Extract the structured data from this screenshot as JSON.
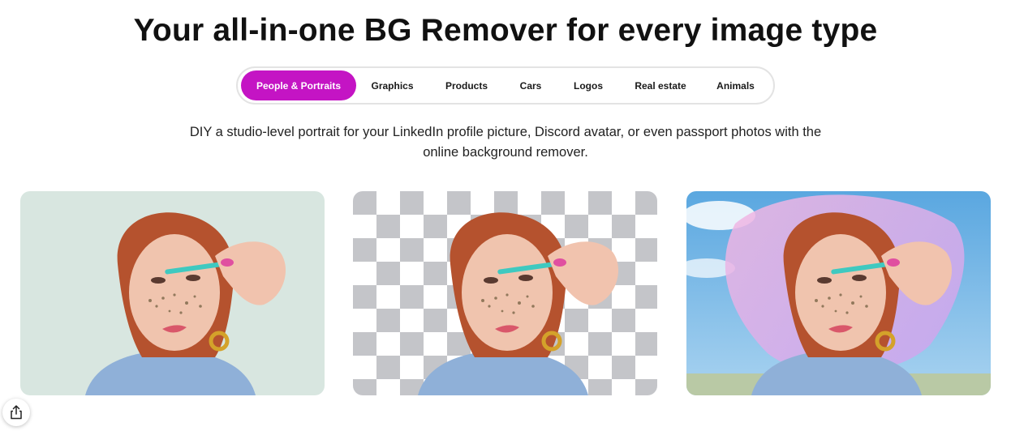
{
  "headline": "Your all-in-one BG Remover for every image type",
  "tabs": [
    {
      "label": "People & Portraits",
      "active": true
    },
    {
      "label": "Graphics",
      "active": false
    },
    {
      "label": "Products",
      "active": false
    },
    {
      "label": "Cars",
      "active": false
    },
    {
      "label": "Logos",
      "active": false
    },
    {
      "label": "Real estate",
      "active": false
    },
    {
      "label": "Animals",
      "active": false
    }
  ],
  "description": "DIY a studio-level portrait for your LinkedIn profile picture, Discord avatar, or even passport photos with the online background remover.",
  "cards": [
    {
      "id": "original",
      "background": "solid-mint"
    },
    {
      "id": "removed",
      "background": "transparent-checkerboard"
    },
    {
      "id": "replaced",
      "background": "sky-with-pink-fabric"
    }
  ],
  "colors": {
    "accent": "#c414c4",
    "checker": "#c4c5c9"
  },
  "icons": {
    "share": "share-icon"
  }
}
